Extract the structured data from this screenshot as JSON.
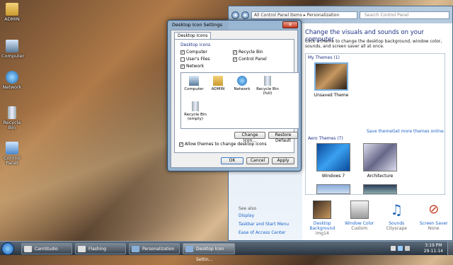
{
  "desktop": {
    "icons": [
      {
        "label": "ADMIN"
      },
      {
        "label": "Computer"
      },
      {
        "label": "Network"
      },
      {
        "label": "Recycle Bin"
      },
      {
        "label": "Control Panel"
      }
    ]
  },
  "personalization": {
    "address": "All Control Panel Items  ▸  Personalization",
    "search_placeholder": "Search Control Panel",
    "title": "Change the visuals and sounds on your computer",
    "description": "Click a theme to change the desktop background, window color, sounds, and screen saver all at once.",
    "my_themes": "My Themes (1)",
    "unsaved_theme": "Unsaved Theme",
    "save_theme": "Save theme",
    "get_more": "Get more themes online",
    "aero_themes": "Aero Themes (7)",
    "themes": [
      {
        "label": "Windows 7"
      },
      {
        "label": "Architecture"
      }
    ],
    "see_also": "See also",
    "see_links": [
      "Display",
      "Taskbar and Start Menu",
      "Ease of Access Center"
    ],
    "bottom": [
      {
        "label": "Desktop Background",
        "sub": "img14"
      },
      {
        "label": "Window Color",
        "sub": "Custom"
      },
      {
        "label": "Sounds",
        "sub": "Cityscape"
      },
      {
        "label": "Screen Saver",
        "sub": "None"
      }
    ]
  },
  "dialog": {
    "title": "Desktop Icon Settings",
    "close": "✕",
    "tab": "Desktop Icons",
    "group": "Desktop icons",
    "checkboxes": [
      {
        "label": "Computer",
        "mark": "✓"
      },
      {
        "label": "User's Files",
        "mark": ""
      },
      {
        "label": "Network",
        "mark": "✓"
      },
      {
        "label": "Recycle Bin",
        "mark": "✓"
      },
      {
        "label": "Control Panel",
        "mark": "✓"
      }
    ],
    "preview": [
      {
        "label": "Computer"
      },
      {
        "label": "ADMIN"
      },
      {
        "label": "Network"
      },
      {
        "label": "Recycle Bin (full)"
      },
      {
        "label": "Recycle Bin (empty)"
      }
    ],
    "change_icon": "Change Icon...",
    "restore_default": "Restore Default",
    "allow_themes": "Allow themes to change desktop icons",
    "allow_mark": "✓",
    "ok": "OK",
    "cancel": "Cancel",
    "apply": "Apply"
  },
  "taskbar": {
    "tasks": [
      "CamStudio",
      "Flashing",
      "Personalization",
      "Desktop Icon Settin..."
    ],
    "time": "3:19 PM",
    "date": "29-11-14"
  }
}
